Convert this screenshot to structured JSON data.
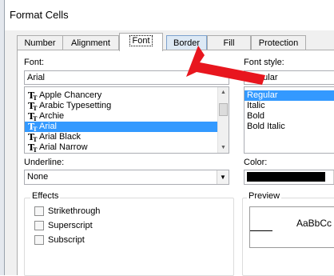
{
  "window": {
    "title": "Format Cells"
  },
  "tabs": [
    {
      "label": "Number"
    },
    {
      "label": "Alignment"
    },
    {
      "label": "Font"
    },
    {
      "label": "Border"
    },
    {
      "label": "Fill"
    },
    {
      "label": "Protection"
    }
  ],
  "font": {
    "label": "Font:",
    "value": "Arial",
    "list": [
      "Apple Chancery",
      "Arabic Typesetting",
      "Archie",
      "Arial",
      "Arial Black",
      "Arial Narrow"
    ],
    "selected": "Arial"
  },
  "font_style": {
    "label": "Font style:",
    "value": "Regular",
    "list": [
      "Regular",
      "Italic",
      "Bold",
      "Bold Italic"
    ],
    "selected": "Regular"
  },
  "underline": {
    "label": "Underline:",
    "value": "None"
  },
  "color": {
    "label": "Color:",
    "swatch": "#000000"
  },
  "effects": {
    "title": "Effects",
    "items": [
      {
        "label": "Strikethrough",
        "checked": false
      },
      {
        "label": "Superscript",
        "checked": false
      },
      {
        "label": "Subscript",
        "checked": false
      }
    ]
  },
  "preview": {
    "title": "Preview",
    "sample": "AaBbCc"
  },
  "icons": {
    "font_type": "truetype-font-icon",
    "annotation": "red-arrow-icon"
  },
  "colors": {
    "selection": "#3399ff",
    "arrow": "#e8161e",
    "border_tab_highlight": "#dde9f5"
  }
}
